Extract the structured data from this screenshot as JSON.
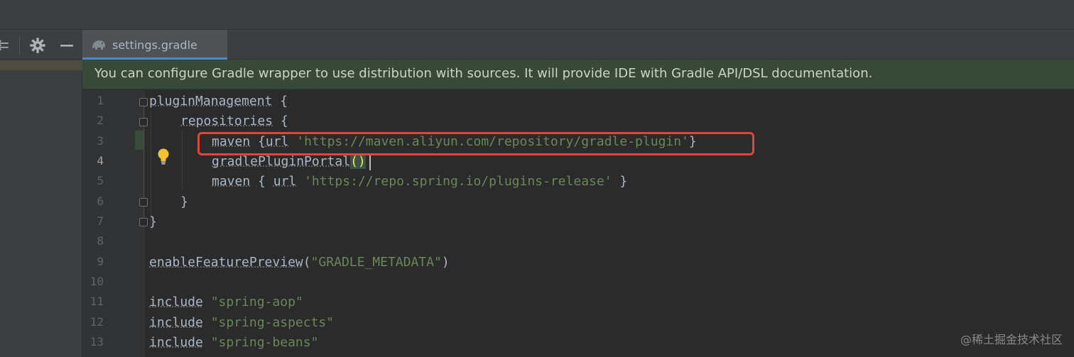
{
  "tab": {
    "label": "settings.gradle"
  },
  "banner": {
    "text": "You can configure Gradle wrapper to use distribution with sources. It will provide IDE with Gradle API/DSL documentation."
  },
  "editor": {
    "current_line": 4,
    "line_numbers": [
      "1",
      "2",
      "3",
      "4",
      "5",
      "6",
      "7",
      "8",
      "9",
      "10",
      "11",
      "12",
      "13"
    ],
    "lines": {
      "l1": {
        "ident": "pluginManagement",
        "rest": " {"
      },
      "l2": {
        "ident": "repositories",
        "rest": " {"
      },
      "l3": {
        "ident": "maven",
        "open": " {",
        "ident2": "url",
        "str": "'https://maven.aliyun.com/repository/gradle-plugin'",
        "close": "}"
      },
      "l4": {
        "ident": "gradlePluginPortal",
        "parens": "()"
      },
      "l5": {
        "ident": "maven",
        "open": " { ",
        "ident2": "url",
        "str": "'https://repo.spring.io/plugins-release'",
        "close": " }"
      },
      "l6": {
        "text": "}"
      },
      "l7": {
        "text": "}"
      },
      "l9": {
        "ident": "enableFeaturePreview",
        "open": "(",
        "str": "\"GRADLE_METADATA\"",
        "close": ")"
      },
      "l11": {
        "ident": "include",
        "str": "\"spring-aop\""
      },
      "l12": {
        "ident": "include",
        "str": "\"spring-aspects\""
      },
      "l13": {
        "ident": "include",
        "str": "\"spring-beans\""
      }
    }
  },
  "watermark": {
    "text": "@稀土掘金技术社区"
  },
  "colors": {
    "highlight": "#e2453b",
    "string": "#6a8759",
    "banner_bg": "#394938",
    "tab_accent": "#4a88c7"
  },
  "icons": [
    "collapse-all-icon",
    "gear-icon",
    "minimize-icon",
    "gradle-elephant-icon",
    "lightbulb-icon"
  ]
}
